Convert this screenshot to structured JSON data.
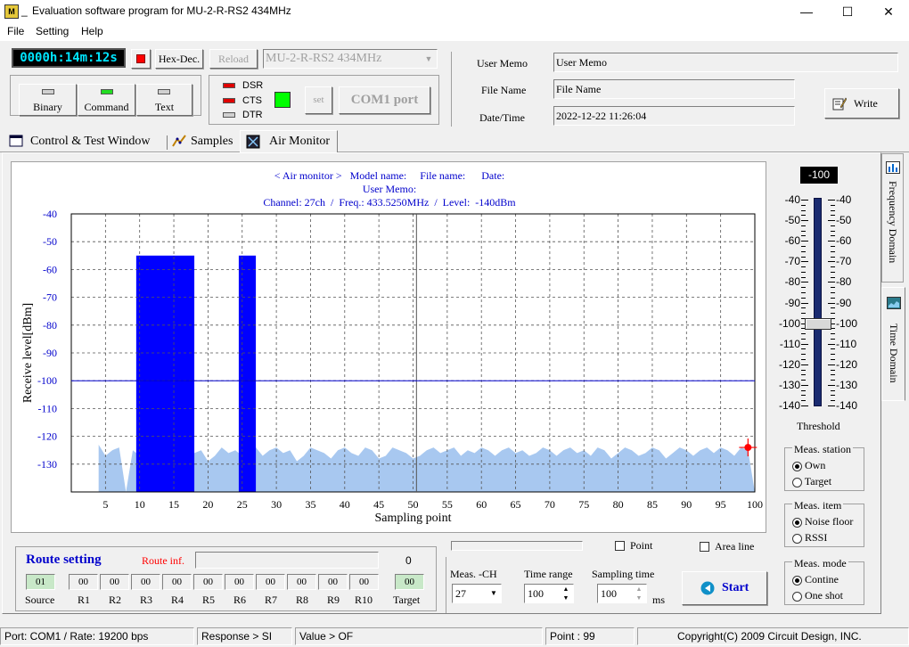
{
  "window": {
    "icon_text": "M",
    "title": "Evaluation software program for MU-2-R-RS2  434MHz",
    "title_prefix": "_",
    "minimize_glyph": "—",
    "maximize_glyph": "☐",
    "close_glyph": "✕"
  },
  "menu": [
    "File",
    "Setting",
    "Help"
  ],
  "toolbar": {
    "timer": "0000h:14m:12s",
    "hexdec_label": "Hex-Dec.",
    "reload_label": "Reload",
    "model_select": "MU-2-R-RS2  434MHz",
    "mode_buttons": [
      "Binary",
      "Command",
      "Text"
    ],
    "signals": [
      "DSR",
      "CTS",
      "DTR"
    ],
    "set_label": "set",
    "com_label": "COM1 port"
  },
  "info": {
    "memo_label": "User Memo",
    "memo_value": "User Memo",
    "file_label": "File Name",
    "file_value": "File Name",
    "date_label": "Date/Time",
    "date_value": "2022-12-22 11:26:04",
    "write_label": "Write"
  },
  "tabs": [
    "Control  & Test Window",
    "Samples",
    "Air Monitor"
  ],
  "side_tabs": [
    "Frequency Domain",
    "Time Domain"
  ],
  "chart_header": {
    "line1": "< Air monitor >   Model name:     File name:      Date:",
    "line2": "User Memo:",
    "line3": "Channel: 27ch  /  Freq.: 433.5250MHz  /  Level:  -140dBm"
  },
  "chart_data": {
    "type": "area",
    "xlabel": "Sampling point",
    "ylabel": "Receive level[dBm]",
    "xlim": [
      0,
      100
    ],
    "ylim": [
      -140,
      -40
    ],
    "xticks": [
      5,
      10,
      15,
      20,
      25,
      30,
      35,
      40,
      45,
      50,
      55,
      60,
      65,
      70,
      75,
      80,
      85,
      90,
      95,
      100
    ],
    "yticks": [
      -40,
      -50,
      -60,
      -70,
      -80,
      -90,
      -100,
      -110,
      -120,
      -130
    ],
    "threshold": -100,
    "cursor_x": 50.5,
    "marker": {
      "x": 99,
      "y": -124
    },
    "noise_floor": {
      "x": [
        4,
        5,
        6,
        7,
        8,
        9,
        10,
        11,
        12,
        13,
        14,
        15,
        16,
        17,
        18,
        19,
        20,
        21,
        22,
        23,
        24,
        25,
        26,
        27,
        28,
        29,
        30,
        31,
        32,
        33,
        34,
        35,
        36,
        37,
        38,
        39,
        40,
        41,
        42,
        43,
        44,
        45,
        46,
        47,
        48,
        49,
        50,
        51,
        52,
        53,
        54,
        55,
        56,
        57,
        58,
        59,
        60,
        61,
        62,
        63,
        64,
        65,
        66,
        67,
        68,
        69,
        70,
        71,
        72,
        73,
        74,
        75,
        76,
        77,
        78,
        79,
        80,
        81,
        82,
        83,
        84,
        85,
        86,
        87,
        88,
        89,
        90,
        91,
        92,
        93,
        94,
        95,
        96,
        97,
        98,
        99,
        100
      ],
      "y": [
        -123,
        -127,
        -125,
        -124,
        -140,
        -125,
        -127,
        -125,
        -126,
        -124,
        -125,
        -126,
        -127,
        -128,
        -126,
        -125,
        -129,
        -127,
        -124,
        -126,
        -125,
        -127,
        -125,
        -124,
        -127,
        -125,
        -124,
        -126,
        -125,
        -129,
        -127,
        -124,
        -125,
        -126,
        -128,
        -125,
        -124,
        -126,
        -127,
        -124,
        -125,
        -128,
        -127,
        -124,
        -125,
        -126,
        -128,
        -127,
        -125,
        -124,
        -126,
        -125,
        -124,
        -127,
        -125,
        -126,
        -124,
        -125,
        -127,
        -125,
        -124,
        -126,
        -125,
        -127,
        -126,
        -124,
        -125,
        -127,
        -125,
        -124,
        -126,
        -125,
        -127,
        -124,
        -125,
        -128,
        -126,
        -124,
        -125,
        -127,
        -126,
        -124,
        -125,
        -128,
        -126,
        -124,
        -125,
        -127,
        -125,
        -124,
        -126,
        -124,
        -125,
        -127,
        -124,
        -125,
        -140
      ]
    },
    "bursts": [
      {
        "x_start": 9.5,
        "x_end": 18,
        "level": -55
      },
      {
        "x_start": 24.5,
        "x_end": 27,
        "level": -55
      }
    ]
  },
  "threshold": {
    "value": "-100",
    "label": "Threshold",
    "scale": [
      "-40",
      "-50",
      "-60",
      "-70",
      "-80",
      "-90",
      "-100",
      "-110",
      "-120",
      "-130",
      "-140"
    ],
    "level": -100
  },
  "meas_station": {
    "title": "Meas. station",
    "options": [
      "Own",
      "Target"
    ],
    "selected": 0
  },
  "meas_item": {
    "title": "Meas. item",
    "options": [
      "Noise floor",
      "RSSI"
    ],
    "selected": 0
  },
  "meas_mode": {
    "title": "Meas. mode",
    "options": [
      "Contine",
      "One shot"
    ],
    "selected": 0
  },
  "options": {
    "point_label": "Point",
    "area_label": "Area line"
  },
  "controls": {
    "ch_label": "Meas. -CH",
    "ch_value": "27",
    "range_label": "Time range",
    "range_value": "100",
    "sampling_label": "Sampling time",
    "sampling_value": "100",
    "ms_label": "ms",
    "start_label": "Start"
  },
  "route": {
    "title": "Route setting",
    "inf_label": "Route inf.",
    "count": "0",
    "source_value": "01",
    "source_label": "Source",
    "repeaters": [
      "00",
      "00",
      "00",
      "00",
      "00",
      "00",
      "00",
      "00",
      "00",
      "00"
    ],
    "repeater_labels": [
      "R1",
      "R2",
      "R3",
      "R4",
      "R5",
      "R6",
      "R7",
      "R8",
      "R9",
      "R10"
    ],
    "target_value": "00",
    "target_label": "Target"
  },
  "status": {
    "port": "Port: COM1 / Rate: 19200 bps",
    "response": "Response > SI",
    "value": "Value > OF",
    "point": "Point : 99",
    "copyright": "Copyright(C) 2009 Circuit Design, INC."
  },
  "colors": {
    "burst": "#0000ff",
    "noise": "#a8c8f0",
    "threshold_line": "#0000cc",
    "marker": "#ff0000",
    "route_title": "#0000cc",
    "route_inf": "#ff0000",
    "timer_bg": "#000000",
    "timer_fg": "#00e5ff"
  }
}
